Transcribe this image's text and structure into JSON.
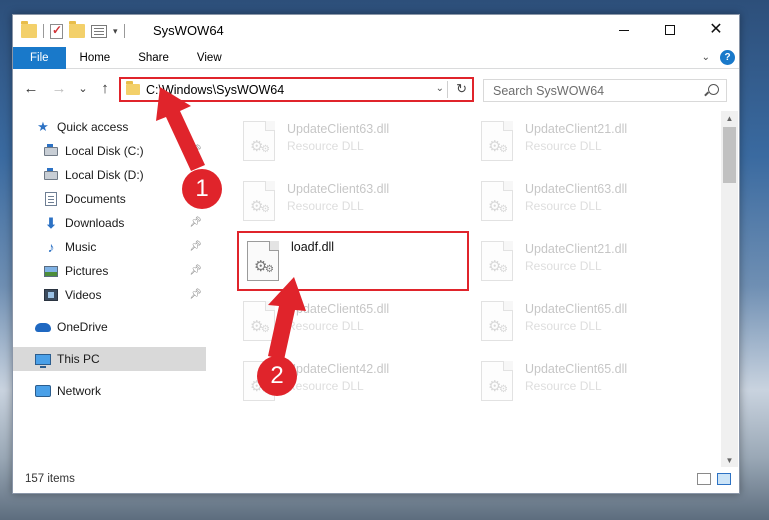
{
  "window": {
    "title": "SysWOW64",
    "controls": {
      "minimize": "—",
      "maximize": "☐",
      "close": "✕"
    }
  },
  "ribbon": {
    "tabs": [
      {
        "label": "File",
        "active": true
      },
      {
        "label": "Home"
      },
      {
        "label": "Share"
      },
      {
        "label": "View"
      }
    ],
    "help_label": "?"
  },
  "nav": {
    "back": "←",
    "forward": "→",
    "recent": "⌄",
    "up": "↑",
    "address": "C:\\Windows\\SysWOW64",
    "search_placeholder": "Search SysWOW64"
  },
  "sidebar": {
    "items": [
      {
        "label": "Quick access",
        "icon": "star-icon"
      },
      {
        "label": "Local Disk (C:)",
        "icon": "drive-icon",
        "pinned": true
      },
      {
        "label": "Local Disk (D:)",
        "icon": "drive-icon"
      },
      {
        "label": "Documents",
        "icon": "document-icon",
        "pinned": true
      },
      {
        "label": "Downloads",
        "icon": "download-icon",
        "pinned": true
      },
      {
        "label": "Music",
        "icon": "music-icon",
        "pinned": true
      },
      {
        "label": "Pictures",
        "icon": "pictures-icon",
        "pinned": true
      },
      {
        "label": "Videos",
        "icon": "videos-icon",
        "pinned": true
      },
      {
        "label": "OneDrive",
        "icon": "onedrive-icon"
      },
      {
        "label": "This PC",
        "icon": "computer-icon",
        "selected": true
      },
      {
        "label": "Network",
        "icon": "network-icon"
      }
    ]
  },
  "files": [
    {
      "name": "UpdateClient63.dll",
      "type": "Resource DLL",
      "faded": true
    },
    {
      "name": "UpdateClient21.dll",
      "type": "Resource DLL",
      "faded": true
    },
    {
      "name": "UpdateClient63.dll",
      "type": "Resource DLL",
      "faded": true
    },
    {
      "name": "UpdateClient63.dll",
      "type": "Resource DLL",
      "faded": true
    },
    {
      "name": "loadf.dll",
      "type": "",
      "highlight": true
    },
    {
      "name": "UpdateClient21.dll",
      "type": "Resource DLL",
      "faded": true
    },
    {
      "name": "UpdateClient65.dll",
      "type": "Resource DLL",
      "faded": true
    },
    {
      "name": "UpdateClient65.dll",
      "type": "Resource DLL",
      "faded": true
    },
    {
      "name": "UpdateClient42.dll",
      "type": "Resource DLL",
      "faded": true
    },
    {
      "name": "UpdateClient65.dll",
      "type": "Resource DLL",
      "faded": true
    }
  ],
  "status": {
    "item_count": "157 items"
  },
  "annotations": {
    "step1": "1",
    "step2": "2",
    "color": "#e0242b"
  }
}
